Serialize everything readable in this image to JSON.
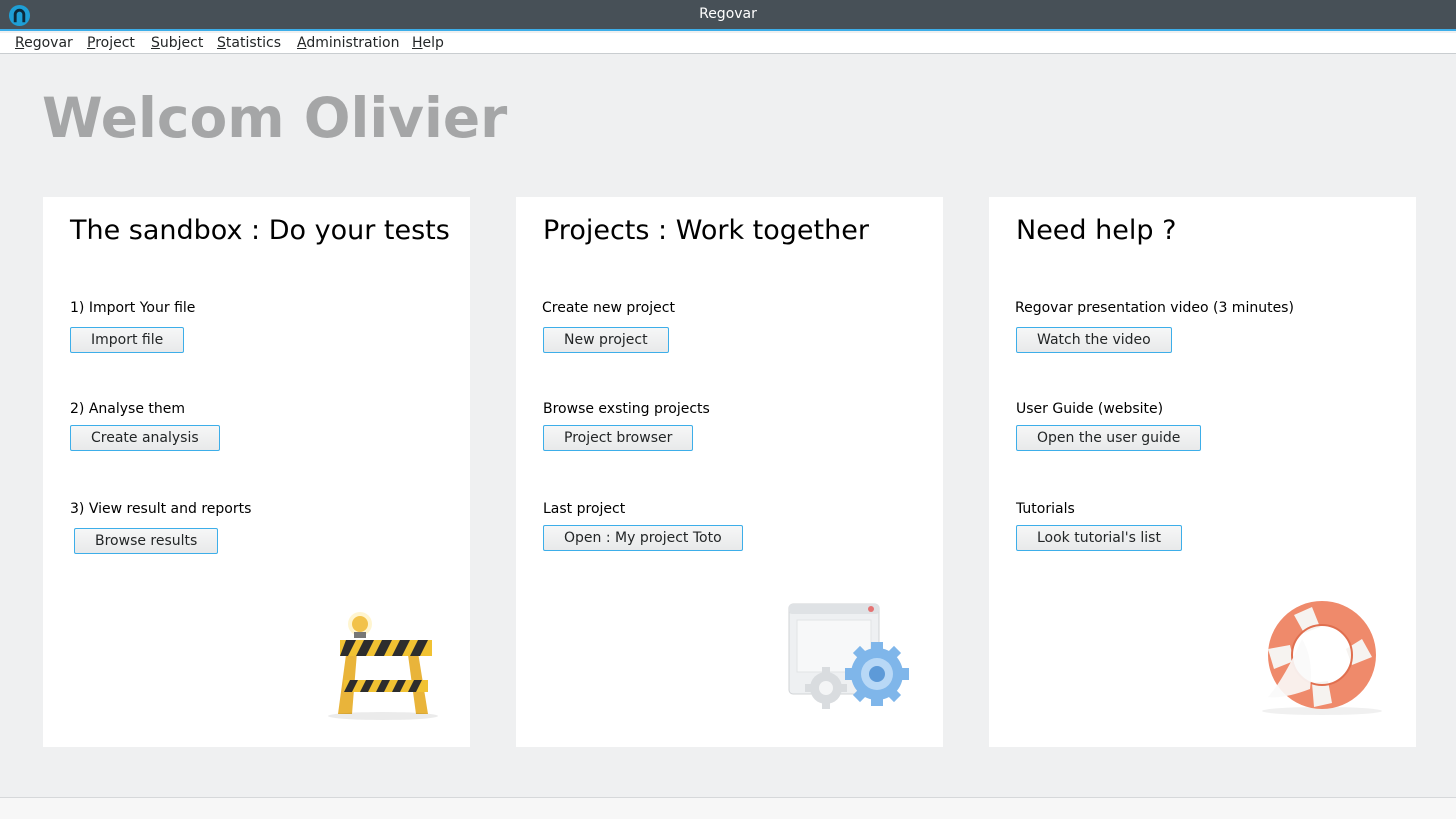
{
  "window": {
    "title": "Regovar"
  },
  "menu": [
    {
      "mnemonic": "R",
      "rest": "egovar"
    },
    {
      "mnemonic": "P",
      "rest": "roject"
    },
    {
      "mnemonic": "S",
      "rest": "ubject"
    },
    {
      "mnemonic": "S",
      "rest": "tatistics"
    },
    {
      "mnemonic": "A",
      "rest": "dministration"
    },
    {
      "mnemonic": "H",
      "rest": "elp"
    }
  ],
  "welcome": "Welcom Olivier",
  "panels": [
    {
      "title": "The sandbox : Do your tests",
      "items": [
        {
          "label": "1) Import Your file",
          "button": "Import file"
        },
        {
          "label": "2) Analyse them",
          "button": "Create analysis"
        },
        {
          "label": "3) View result and reports",
          "button": "Browse results"
        }
      ],
      "illustration": "construction-barrier-icon"
    },
    {
      "title": "Projects : Work together",
      "items": [
        {
          "label": "Create new project",
          "button": "New project"
        },
        {
          "label": "Browse exsting projects",
          "button": "Project browser"
        },
        {
          "label": "Last project",
          "button": "Open : My project Toto"
        }
      ],
      "illustration": "window-gears-icon"
    },
    {
      "title": "Need help ?",
      "items": [
        {
          "label": "Regovar presentation video (3 minutes)",
          "button": "Watch the video"
        },
        {
          "label": "User Guide (website)",
          "button": "Open the user guide"
        },
        {
          "label": "Tutorials",
          "button": "Look tutorial's list"
        }
      ],
      "illustration": "lifebuoy-icon"
    }
  ],
  "colors": {
    "titlebar": "#475057",
    "accent": "#3daee9",
    "background": "#eff0f1",
    "welcome_text": "#a5a6a7"
  }
}
